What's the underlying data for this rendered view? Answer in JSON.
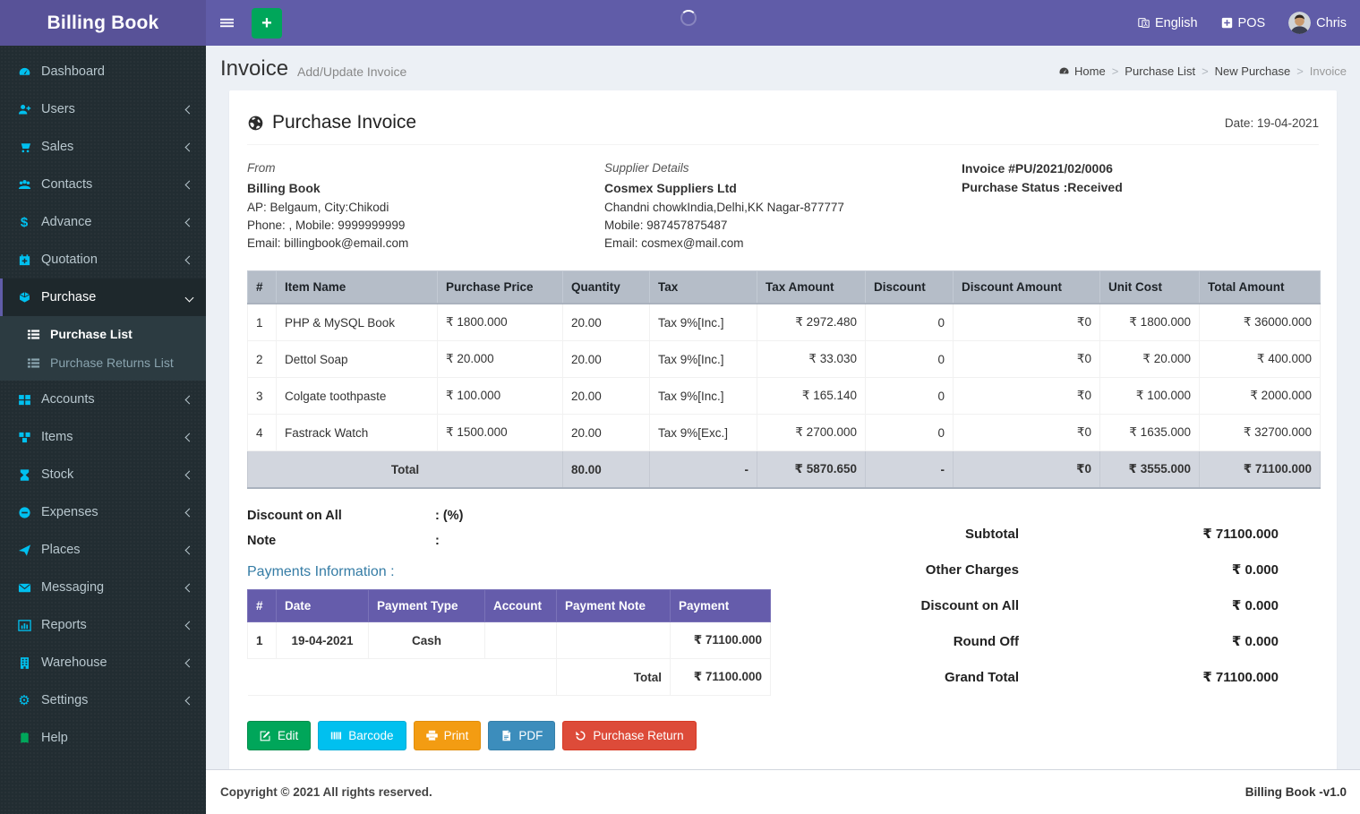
{
  "app": {
    "title": "Billing Book",
    "version_label": "Billing Book -v1.0",
    "copyright": "Copyright © 2021 All rights reserved."
  },
  "header": {
    "language_label": "English",
    "pos_label": "POS",
    "user_name": "Chris"
  },
  "sidebar": {
    "items": [
      {
        "label": "Dashboard"
      },
      {
        "label": "Users"
      },
      {
        "label": "Sales"
      },
      {
        "label": "Contacts"
      },
      {
        "label": "Advance"
      },
      {
        "label": "Quotation"
      },
      {
        "label": "Purchase"
      },
      {
        "label": "Accounts"
      },
      {
        "label": "Items"
      },
      {
        "label": "Stock"
      },
      {
        "label": "Expenses"
      },
      {
        "label": "Places"
      },
      {
        "label": "Messaging"
      },
      {
        "label": "Reports"
      },
      {
        "label": "Warehouse"
      },
      {
        "label": "Settings"
      },
      {
        "label": "Help"
      }
    ],
    "purchase_submenu": [
      {
        "label": "Purchase List"
      },
      {
        "label": "Purchase Returns List"
      }
    ]
  },
  "page": {
    "title": "Invoice",
    "subtitle": "Add/Update Invoice",
    "breadcrumb": {
      "home": "Home",
      "level1": "Purchase List",
      "level2": "New Purchase",
      "current": "Invoice"
    }
  },
  "invoice": {
    "section_title": "Purchase Invoice",
    "date": "Date: 19-04-2021",
    "from_title": "From",
    "from_name": "Billing Book",
    "from_address": "AP: Belgaum, City:Chikodi",
    "from_phone": "Phone: , Mobile: 9999999999",
    "from_email": "Email: billingbook@email.com",
    "supplier_title": "Supplier Details",
    "supplier_name": "Cosmex Suppliers Ltd",
    "supplier_address": "Chandni chowkIndia,Delhi,KK Nagar-877777",
    "supplier_mobile": "Mobile: 987457875487",
    "supplier_email": "Email: cosmex@mail.com",
    "number": "Invoice #PU/2021/02/0006",
    "status": "Purchase Status :Received"
  },
  "items_table": {
    "headers": [
      "#",
      "Item Name",
      "Purchase Price",
      "Quantity",
      "Tax",
      "Tax Amount",
      "Discount",
      "Discount Amount",
      "Unit Cost",
      "Total Amount"
    ],
    "rows": [
      [
        "1",
        "PHP & MySQL Book",
        "₹ 1800.000",
        "20.00",
        "Tax 9%[Inc.]",
        "₹ 2972.480",
        "0",
        "₹0",
        "₹ 1800.000",
        "₹ 36000.000"
      ],
      [
        "2",
        "Dettol Soap",
        "₹ 20.000",
        "20.00",
        "Tax 9%[Inc.]",
        "₹ 33.030",
        "0",
        "₹0",
        "₹ 20.000",
        "₹ 400.000"
      ],
      [
        "3",
        "Colgate toothpaste",
        "₹ 100.000",
        "20.00",
        "Tax 9%[Inc.]",
        "₹ 165.140",
        "0",
        "₹0",
        "₹ 100.000",
        "₹ 2000.000"
      ],
      [
        "4",
        "Fastrack Watch",
        "₹ 1500.000",
        "20.00",
        "Tax 9%[Exc.]",
        "₹ 2700.000",
        "0",
        "₹0",
        "₹ 1635.000",
        "₹ 32700.000"
      ]
    ],
    "total_row": {
      "label": "Total",
      "quantity": "80.00",
      "tax": "-",
      "tax_amount": "₹ 5870.650",
      "discount": "-",
      "discount_amount": "₹0",
      "unit_cost": "₹ 3555.000",
      "total_amount": "₹ 71100.000"
    }
  },
  "discount_note": {
    "discount_label": "Discount on All",
    "discount_value": ": (%)",
    "note_label": "Note",
    "note_value": ":",
    "payments_heading": "Payments Information :"
  },
  "payments_table": {
    "headers": [
      "#",
      "Date",
      "Payment Type",
      "Account",
      "Payment Note",
      "Payment"
    ],
    "rows": [
      [
        "1",
        "19-04-2021",
        "Cash",
        "",
        "",
        "₹ 71100.000"
      ]
    ],
    "total_label": "Total",
    "total_value": "₹ 71100.000"
  },
  "summary": {
    "rows": [
      {
        "label": "Subtotal",
        "value": "₹ 71100.000"
      },
      {
        "label": "Other Charges",
        "value": "₹ 0.000"
      },
      {
        "label": "Discount on All",
        "value": "₹ 0.000"
      },
      {
        "label": "Round Off",
        "value": "₹ 0.000"
      },
      {
        "label": "Grand Total",
        "value": "₹ 71100.000"
      }
    ]
  },
  "buttons": [
    {
      "label": "Edit"
    },
    {
      "label": "Barcode"
    },
    {
      "label": "Print"
    },
    {
      "label": "PDF"
    },
    {
      "label": "Purchase Return"
    }
  ],
  "colors": {
    "navbar_purple": "#605ca8",
    "logo_purple": "#585298",
    "sidebar_dark": "#222d32",
    "sidebar_icon_cyan": "#00c0ef",
    "table_header_gray": "#b5bdc8",
    "total_row_gray": "#d2d6de",
    "payments_header_purple": "#655cab",
    "heading_teal": "#357ca5",
    "btn_green": "#00a65a",
    "btn_cyan": "#00c0ef",
    "btn_orange": "#f39c12",
    "btn_blue": "#3c8dbc",
    "btn_red": "#dd4b39",
    "content_bg": "#ecf0f5"
  }
}
